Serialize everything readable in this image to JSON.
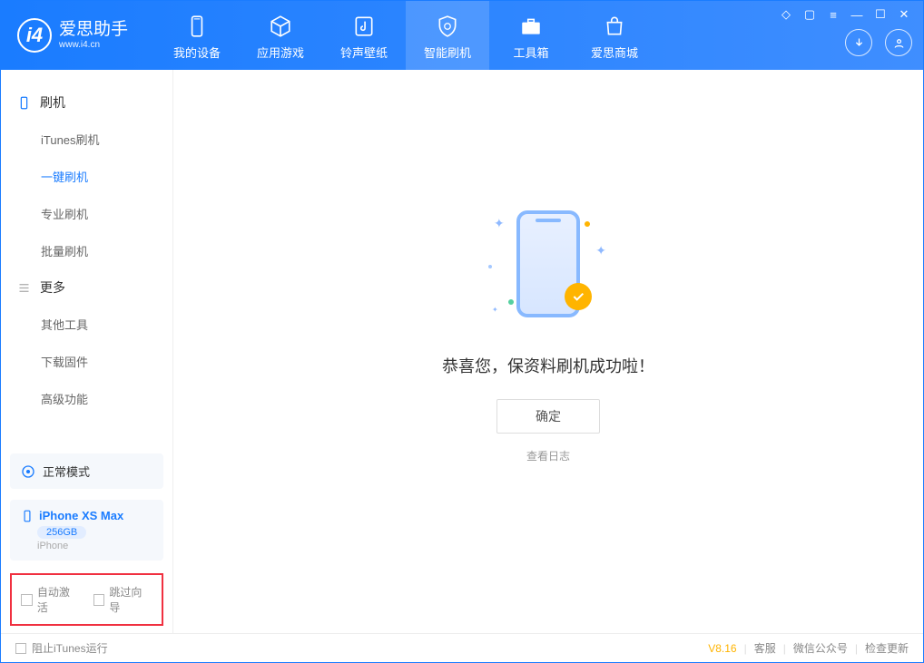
{
  "app": {
    "logo_title": "爱思助手",
    "logo_sub": "www.i4.cn"
  },
  "tabs": [
    {
      "label": "我的设备"
    },
    {
      "label": "应用游戏"
    },
    {
      "label": "铃声壁纸"
    },
    {
      "label": "智能刷机"
    },
    {
      "label": "工具箱"
    },
    {
      "label": "爱思商城"
    }
  ],
  "sidebar": {
    "cat_flash": "刷机",
    "items_flash": [
      "iTunes刷机",
      "一键刷机",
      "专业刷机",
      "批量刷机"
    ],
    "cat_more": "更多",
    "items_more": [
      "其他工具",
      "下载固件",
      "高级功能"
    ],
    "mode_label": "正常模式",
    "device_name": "iPhone XS Max",
    "device_storage": "256GB",
    "device_type": "iPhone",
    "chk_auto_activate": "自动激活",
    "chk_skip_guide": "跳过向导"
  },
  "main": {
    "success_title": "恭喜您，保资料刷机成功啦！",
    "confirm": "确定",
    "view_log": "查看日志"
  },
  "footer": {
    "block_itunes": "阻止iTunes运行",
    "version": "V8.16",
    "support": "客服",
    "wechat": "微信公众号",
    "check_update": "检查更新"
  }
}
